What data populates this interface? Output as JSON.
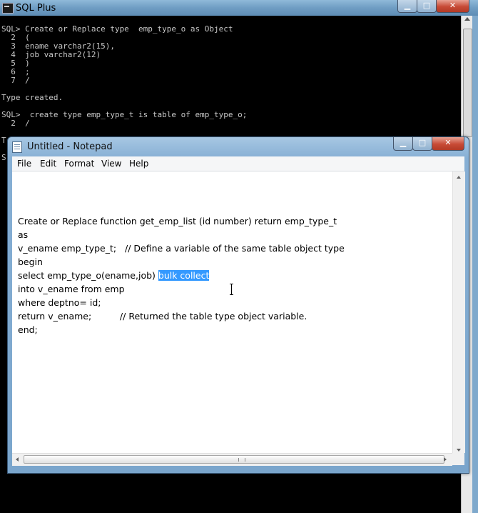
{
  "sqlplus": {
    "title": "SQL Plus",
    "console_lines": [
      "SQL> Create or Replace type  emp_type_o as Object",
      "  2  (",
      "  3  ename varchar2(15),",
      "  4  job varchar2(12)",
      "  5  )",
      "  6  ;",
      "  7  /",
      "",
      "Type created.",
      "",
      "SQL>  create type emp_type_t is table of emp_type_o;",
      "  2  /",
      "",
      "T",
      "",
      "S"
    ]
  },
  "notepad": {
    "title": "Untitled - Notepad",
    "menu": [
      "File",
      "Edit",
      "Format",
      "View",
      "Help"
    ],
    "lines": [
      "Create or Replace function get_emp_list (id number) return emp_type_t",
      "as",
      "v_ename emp_type_t;   // Define a variable of the same table object type",
      "begin",
      "select emp_type_o(ename,job) ",
      "into v_ename from emp",
      "where deptno= id;",
      "return v_ename;          // Returned the table type object variable.",
      "end;"
    ],
    "selected_text": "bulk collect"
  },
  "icons": {
    "minimize": "minimize-icon",
    "maximize": "maximize-icon",
    "close": "close-icon"
  }
}
